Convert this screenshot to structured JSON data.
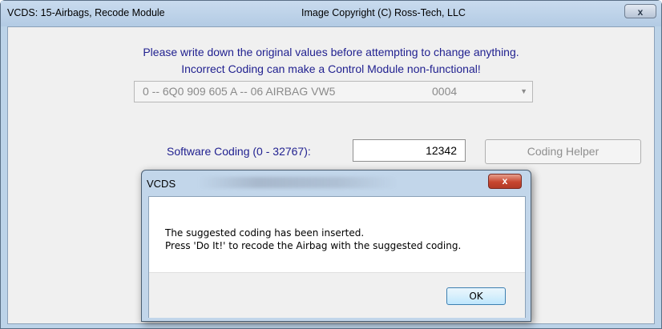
{
  "window": {
    "title": "VCDS: 15-Airbags,  Recode Module",
    "copyright": "Image Copyright (C) Ross-Tech, LLC",
    "close_icon": "close-icon"
  },
  "main": {
    "warning_line1": "Please write down the original values before attempting to change anything.",
    "warning_line2": "Incorrect Coding can make a Control Module non-functional!",
    "module_select": {
      "value": "0 -- 6Q0 909 605 A -- 06 AIRBAG VW5",
      "coding": "0004",
      "arrow": "▼"
    },
    "software_coding_label": "Software Coding (0 - 32767):",
    "software_coding_value": "12342",
    "coding_helper_label": "Coding Helper"
  },
  "dialog": {
    "title": "VCDS",
    "close_glyph": "x",
    "message_line1": "The suggested coding has been inserted.",
    "message_line2": "Press 'Do It!' to recode the Airbag with the suggested coding.",
    "ok_label": "OK"
  }
}
